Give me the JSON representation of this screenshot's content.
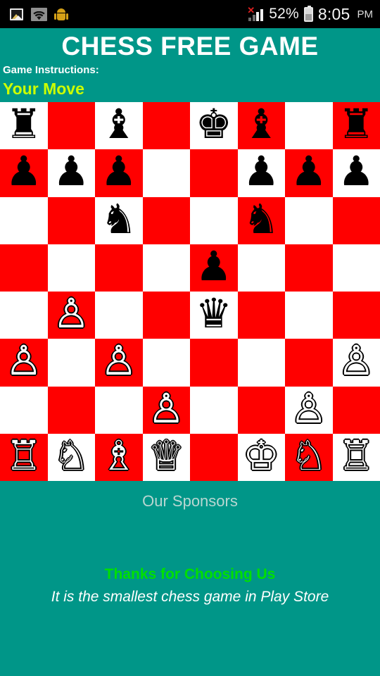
{
  "status_bar": {
    "gallery_icon": "gallery-icon",
    "wifi_icon": "wifi-icon",
    "android_icon": "android-icon",
    "signal_icon": "signal-no-service-icon",
    "signal_x": "✕",
    "battery_percent": "52%",
    "battery_icon": "battery-icon",
    "time": "8:05",
    "ampm": "PM"
  },
  "header": {
    "title": "CHESS FREE GAME",
    "instructions_label": "Game Instructions:",
    "instructions_value": "Your Move"
  },
  "colors": {
    "background_teal": "#009688",
    "square_light": "#ffffff",
    "square_dark": "#ff0000",
    "status_accent": "#ccff00",
    "footer_green": "#00e000"
  },
  "board": {
    "files": [
      "a",
      "b",
      "c",
      "d",
      "e",
      "f",
      "g",
      "h"
    ],
    "ranks": [
      "8",
      "7",
      "6",
      "5",
      "4",
      "3",
      "2",
      "1"
    ],
    "glyphs": {
      "K": "♔",
      "Q": "♕",
      "R": "♖",
      "B": "♗",
      "N": "♘",
      "P": "♙",
      "k": "♚",
      "q": "♛",
      "r": "♜",
      "b": "♝",
      "n": "♞",
      "p": "♟"
    },
    "names": {
      "K": "white-king",
      "Q": "white-queen",
      "R": "white-rook",
      "B": "white-bishop",
      "N": "white-knight",
      "P": "white-pawn",
      "k": "black-king",
      "q": "black-queen",
      "r": "black-rook",
      "b": "black-bishop",
      "n": "black-knight",
      "p": "black-pawn"
    },
    "rows": [
      [
        "r",
        "",
        "b",
        "",
        "k",
        "b",
        "",
        "r"
      ],
      [
        "p",
        "p",
        "p",
        "",
        "",
        "p",
        "p",
        "p"
      ],
      [
        "",
        "",
        "n",
        "",
        "",
        "n",
        "",
        ""
      ],
      [
        "",
        "",
        "",
        "",
        "p",
        "",
        "",
        ""
      ],
      [
        "",
        "P",
        "",
        "",
        "q",
        "",
        "",
        ""
      ],
      [
        "P",
        "",
        "P",
        "",
        "",
        "",
        "",
        "P"
      ],
      [
        "",
        "",
        "",
        "P",
        "",
        "",
        "P",
        ""
      ],
      [
        "R",
        "N",
        "B",
        "Q",
        "",
        "K",
        "N",
        "R"
      ]
    ]
  },
  "sponsors": {
    "label": "Our Sponsors"
  },
  "footer": {
    "headline": "Thanks for Choosing Us",
    "subline": "It is the smallest chess game in Play Store"
  }
}
